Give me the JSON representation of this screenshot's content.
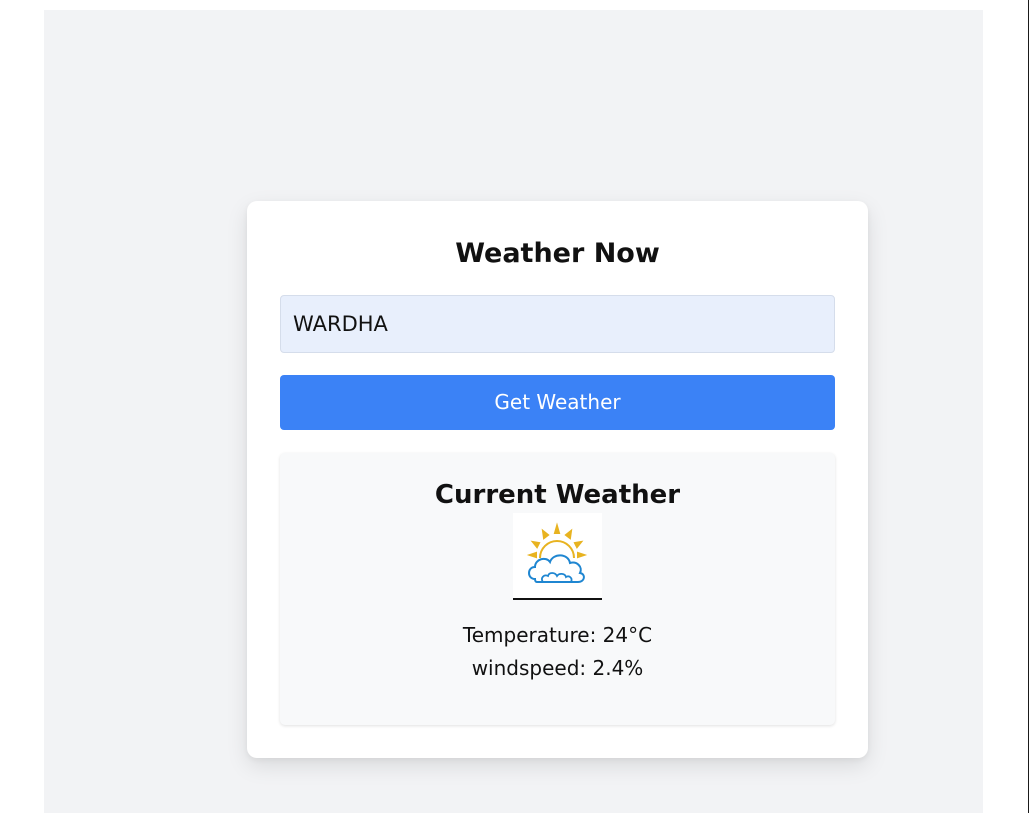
{
  "app": {
    "title": "Weather Now"
  },
  "search": {
    "value": "WARDHA",
    "button_label": "Get Weather"
  },
  "result": {
    "heading": "Current Weather",
    "icon": "partly-cloudy-icon",
    "temperature_text": "Temperature: 24°C",
    "windspeed_text": "windspeed: 2.4%"
  },
  "colors": {
    "accent": "#3b82f6",
    "input_bg": "#e8effc",
    "page_bg": "#f2f3f5",
    "panel_bg": "#f8f9fa",
    "sun": "#e8b320",
    "cloud": "#1f86d1"
  }
}
